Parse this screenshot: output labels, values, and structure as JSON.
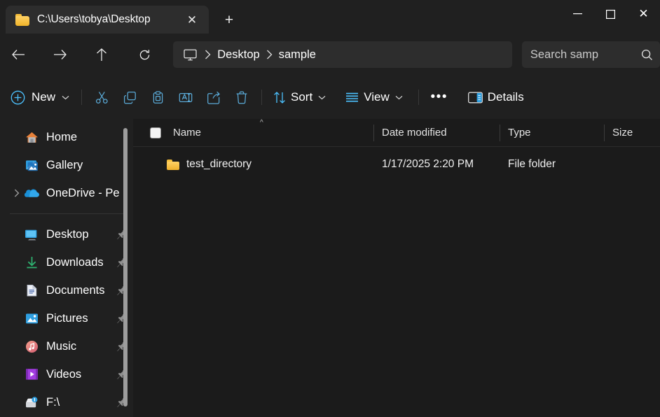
{
  "window": {
    "tab": {
      "title": "C:\\Users\\tobya\\Desktop",
      "folder_icon": "folder-icon",
      "close_icon": "✕"
    },
    "new_tab_icon": "+",
    "controls": {
      "minimize": "—",
      "maximize": "maximize-icon",
      "close": "✕"
    }
  },
  "address_bar": {
    "back_icon": "arrow-left-icon",
    "forward_icon": "arrow-right-icon",
    "up_icon": "arrow-up-icon",
    "refresh_icon": "refresh-icon",
    "breadcrumb": {
      "root_icon": "monitor-icon",
      "separator": "›",
      "items": [
        "Desktop",
        "sample"
      ]
    },
    "search": {
      "placeholder": "Search samp",
      "icon": "search-icon"
    }
  },
  "toolbar": {
    "new_label": "New",
    "new_icon": "plus-circle-icon",
    "new_chevron": "chevron-down-icon",
    "cut_icon": "scissors-icon",
    "copy_icon": "copy-icon",
    "paste_icon": "paste-icon",
    "rename_icon": "rename-icon",
    "share_icon": "share-icon",
    "delete_icon": "trash-icon",
    "sort_label": "Sort",
    "sort_icon": "sort-arrows-icon",
    "view_label": "View",
    "view_icon": "view-lines-icon",
    "more_label": "•••",
    "details_label": "Details",
    "details_icon": "details-panel-icon"
  },
  "sidebar": {
    "items": [
      {
        "label": "Home",
        "icon": "home-icon",
        "pinned": false,
        "expandable": false
      },
      {
        "label": "Gallery",
        "icon": "gallery-icon",
        "pinned": false,
        "expandable": false
      },
      {
        "label": "OneDrive - Pe",
        "icon": "onedrive-icon",
        "pinned": false,
        "expandable": true
      },
      {
        "label": "Desktop",
        "icon": "desktop-icon",
        "pinned": true,
        "expandable": false
      },
      {
        "label": "Downloads",
        "icon": "downloads-icon",
        "pinned": true,
        "expandable": false
      },
      {
        "label": "Documents",
        "icon": "documents-icon",
        "pinned": true,
        "expandable": false
      },
      {
        "label": "Pictures",
        "icon": "pictures-icon",
        "pinned": true,
        "expandable": false
      },
      {
        "label": "Music",
        "icon": "music-icon",
        "pinned": true,
        "expandable": false
      },
      {
        "label": "Videos",
        "icon": "videos-icon",
        "pinned": true,
        "expandable": false
      },
      {
        "label": "F:\\",
        "icon": "drive-icon",
        "pinned": true,
        "expandable": false
      }
    ]
  },
  "file_list": {
    "columns": [
      "Name",
      "Date modified",
      "Type",
      "Size"
    ],
    "sort_indicator": "^",
    "rows": [
      {
        "name": "test_directory",
        "date_modified": "1/17/2025 2:20 PM",
        "type": "File folder",
        "size": "",
        "icon": "folder-icon"
      }
    ]
  },
  "colors": {
    "accent": "#4cc2ff",
    "window_bg": "#202020",
    "content_bg": "#1b1b1b",
    "field_bg": "#2d2d2d",
    "folder_yellow": "#f0b429"
  }
}
